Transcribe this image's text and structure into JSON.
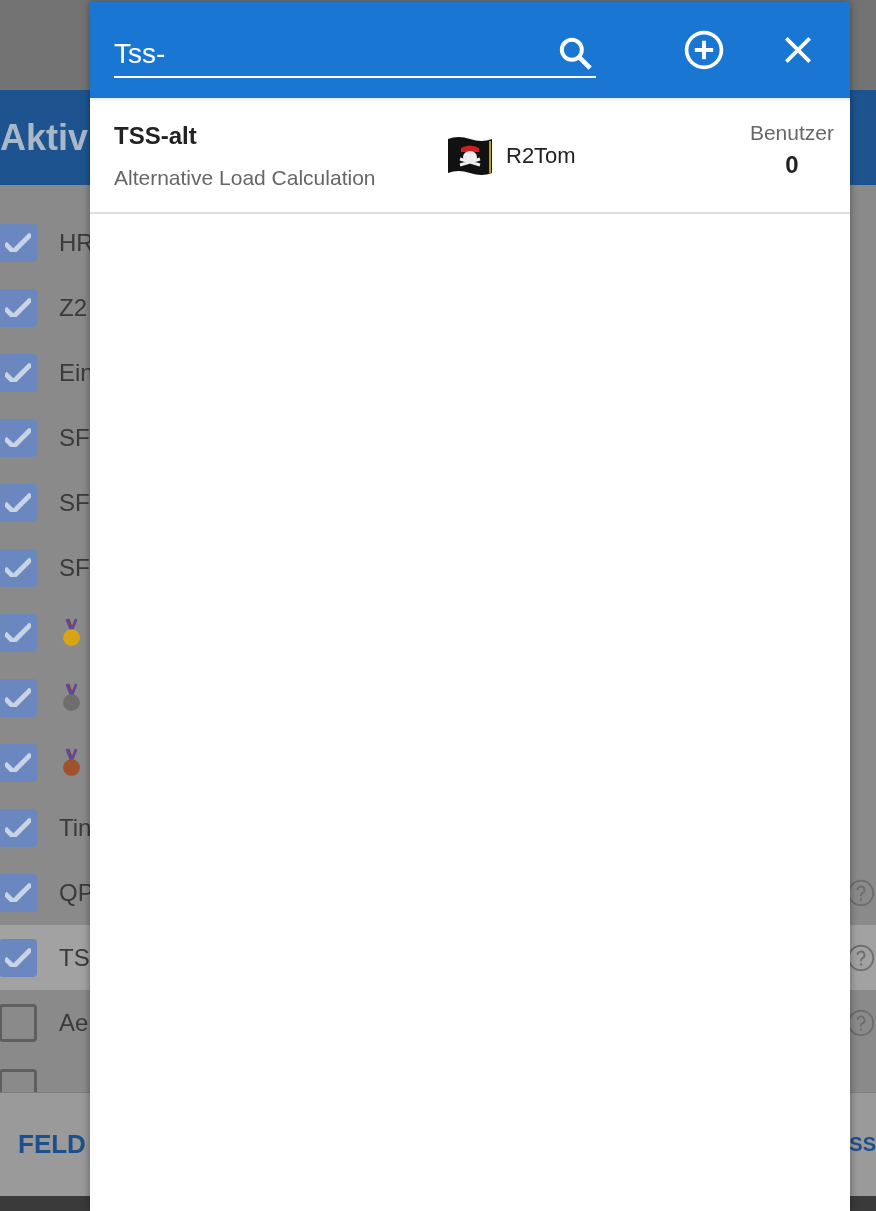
{
  "page": {
    "header_title": "Aktiv",
    "rows": [
      {
        "kind": "text",
        "label": "HR",
        "checked": true,
        "selected": false,
        "help": false
      },
      {
        "kind": "text",
        "label": "Z2",
        "checked": true,
        "selected": false,
        "help": false
      },
      {
        "kind": "text",
        "label": "Ein",
        "checked": true,
        "selected": false,
        "help": false
      },
      {
        "kind": "text",
        "label": "SF",
        "checked": true,
        "selected": false,
        "help": false
      },
      {
        "kind": "text",
        "label": "SF",
        "checked": true,
        "selected": false,
        "help": false
      },
      {
        "kind": "text",
        "label": "SF",
        "checked": true,
        "selected": false,
        "help": false
      },
      {
        "kind": "medal",
        "color": "#d9a514",
        "checked": true,
        "selected": false,
        "help": false
      },
      {
        "kind": "medal",
        "color": "#6e6e6e",
        "checked": true,
        "selected": false,
        "help": false
      },
      {
        "kind": "medal",
        "color": "#a0522d",
        "checked": true,
        "selected": false,
        "help": false
      },
      {
        "kind": "text",
        "label": "Tin",
        "checked": true,
        "selected": false,
        "help": false
      },
      {
        "kind": "text",
        "label": "QP",
        "checked": true,
        "selected": false,
        "help": true
      },
      {
        "kind": "text",
        "label": "TS",
        "checked": true,
        "selected": true,
        "help": true
      },
      {
        "kind": "text",
        "label": "Ae",
        "checked": false,
        "selected": false,
        "help": true
      },
      {
        "kind": "empty",
        "checked": false,
        "selected": false,
        "help": false
      }
    ],
    "footer_buttons": [
      "FELD",
      "SS"
    ]
  },
  "dialog": {
    "search": {
      "value": "Tss-"
    },
    "results": [
      {
        "title": "TSS-alt",
        "description": "Alternative Load Calculation",
        "author": "R2Tom",
        "users_label": "Benutzer",
        "users": "0"
      }
    ]
  }
}
